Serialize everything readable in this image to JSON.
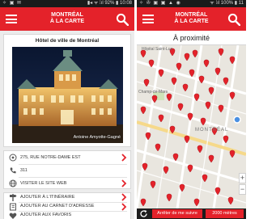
{
  "left_screen": {
    "status": {
      "left_icons": "✧ ▣ ✉",
      "right_text": "▮◂ ᯤ ⁞ıl 92% ▮ 10:08"
    },
    "app_name_line1": "MONTRÉAL",
    "app_name_line2": "À LA CARTE",
    "place_title": "Hôtel de ville de Montréal",
    "photo_credit": "Antoine Amyotte-Gagné",
    "address": "275, RUE NOTRE-DAME EST",
    "phone": "311",
    "website": "VISITER LE SITE WEB",
    "add_itinerary": "AJOUTER À L'ITINÉRAIRE",
    "add_addressbook": "AJOUTER AU CARNET D'ADRESSE",
    "add_favorites": "AJOUTER AUX FAVORIS"
  },
  "right_screen": {
    "status": {
      "left_icons": "✧ ✇ ▣ ▣ ▲ ◉",
      "right_text": "ᯤ ⁞ıl 100% ▮ 11"
    },
    "app_name_line1": "MONTRÉAL",
    "app_name_line2": "À LA CARTE",
    "nearby_title": "À proximité",
    "map_labels": {
      "hospital": "Hôpital Saint-Luc",
      "champ": "Champ-de-Mars",
      "montreal": "MONTRÉAL"
    },
    "stop_following": "Arrêter de me suivre",
    "distance": "2000 mètres",
    "zoom_in": "+",
    "zoom_out": "−"
  },
  "colors": {
    "brand_red": "#e4222a",
    "dark": "#1d1d1d",
    "map_bg": "#e9e6df"
  }
}
